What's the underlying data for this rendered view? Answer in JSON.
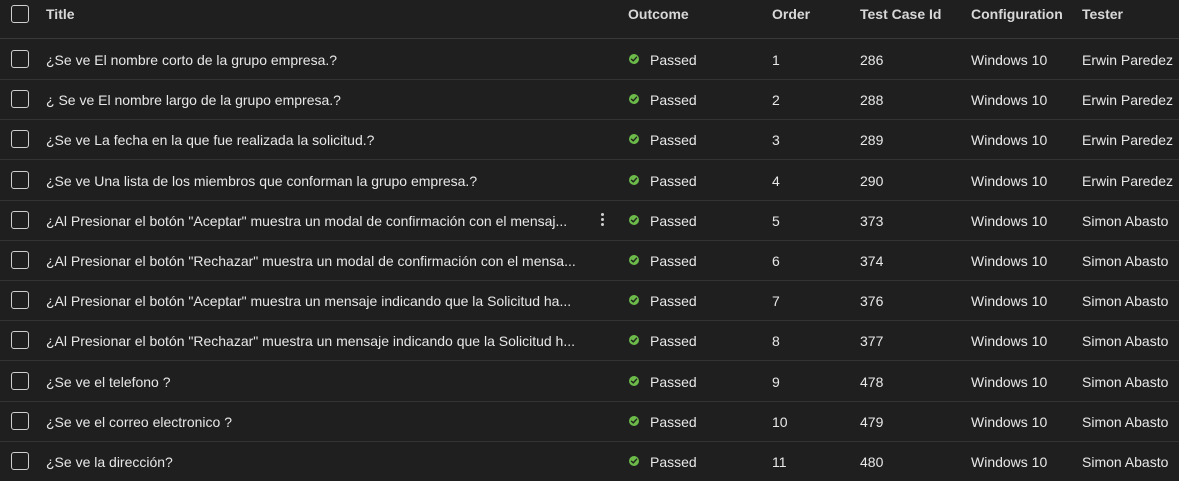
{
  "colors": {
    "passed": "#6cbb4a"
  },
  "header": {
    "title": "Title",
    "outcome": "Outcome",
    "order": "Order",
    "test_case_id": "Test Case Id",
    "configuration": "Configuration",
    "tester": "Tester"
  },
  "rows": [
    {
      "title": "¿Se ve El nombre corto de la grupo empresa.?",
      "outcome": "Passed",
      "order": "1",
      "test_case_id": "286",
      "configuration": "Windows 10",
      "tester": "Erwin Paredez"
    },
    {
      "title": "¿ Se ve El nombre largo de la grupo empresa.?",
      "outcome": "Passed",
      "order": "2",
      "test_case_id": "288",
      "configuration": "Windows 10",
      "tester": "Erwin Paredez"
    },
    {
      "title": "¿Se ve La fecha en la que fue realizada la solicitud.?",
      "outcome": "Passed",
      "order": "3",
      "test_case_id": "289",
      "configuration": "Windows 10",
      "tester": "Erwin Paredez"
    },
    {
      "title": "¿Se ve Una lista de los miembros que conforman la grupo empresa.?",
      "outcome": "Passed",
      "order": "4",
      "test_case_id": "290",
      "configuration": "Windows 10",
      "tester": "Erwin Paredez"
    },
    {
      "title": "¿Al Presionar el botón \"Aceptar\" muestra un modal de confirmación con el mensaj...",
      "outcome": "Passed",
      "order": "5",
      "test_case_id": "373",
      "configuration": "Windows 10",
      "tester": "Simon Abasto"
    },
    {
      "title": "¿Al Presionar el botón \"Rechazar\" muestra un modal de confirmación con el mensa...",
      "outcome": "Passed",
      "order": "6",
      "test_case_id": "374",
      "configuration": "Windows 10",
      "tester": "Simon Abasto"
    },
    {
      "title": "¿Al Presionar el botón \"Aceptar\" muestra un mensaje indicando que la Solicitud ha...",
      "outcome": "Passed",
      "order": "7",
      "test_case_id": "376",
      "configuration": "Windows 10",
      "tester": "Simon Abasto"
    },
    {
      "title": "¿Al Presionar el botón \"Rechazar\" muestra un mensaje indicando que la Solicitud h...",
      "outcome": "Passed",
      "order": "8",
      "test_case_id": "377",
      "configuration": "Windows 10",
      "tester": "Simon Abasto"
    },
    {
      "title": "¿Se ve el telefono ?",
      "outcome": "Passed",
      "order": "9",
      "test_case_id": "478",
      "configuration": "Windows 10",
      "tester": "Simon Abasto"
    },
    {
      "title": "¿Se ve el correo electronico ?",
      "outcome": "Passed",
      "order": "10",
      "test_case_id": "479",
      "configuration": "Windows 10",
      "tester": "Simon Abasto"
    },
    {
      "title": "¿Se ve la dirección?",
      "outcome": "Passed",
      "order": "11",
      "test_case_id": "480",
      "configuration": "Windows 10",
      "tester": "Simon Abasto"
    }
  ]
}
